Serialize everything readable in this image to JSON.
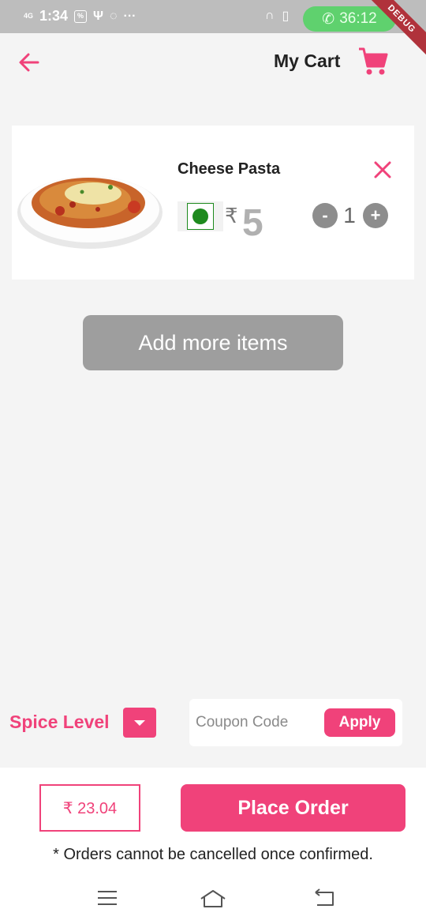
{
  "status_bar": {
    "network": "4G",
    "time": "1:34",
    "call_timer": "36:12",
    "debug_banner": "DEBUG"
  },
  "app_bar": {
    "title": "My Cart",
    "back_icon": "arrow-left-icon",
    "cart_icon": "shopping-cart-icon"
  },
  "cart": {
    "items": [
      {
        "name": "Cheese Pasta",
        "currency": "₹",
        "price": "5",
        "quantity": "1",
        "veg": true,
        "image": "pasta-plate"
      }
    ],
    "qty_minus": "-",
    "qty_plus": "+"
  },
  "add_more_label": "Add more items",
  "spice": {
    "label": "Spice Level"
  },
  "coupon": {
    "placeholder": "Coupon Code",
    "apply_label": "Apply"
  },
  "order": {
    "currency": "₹",
    "total": "23.04",
    "place_order_label": "Place Order",
    "disclaimer": "* Orders cannot be cancelled once confirmed."
  },
  "colors": {
    "accent": "#f0427a",
    "veg_green": "#1e8a1e",
    "button_grey": "#9e9e9e",
    "background": "#f4f4f4"
  }
}
